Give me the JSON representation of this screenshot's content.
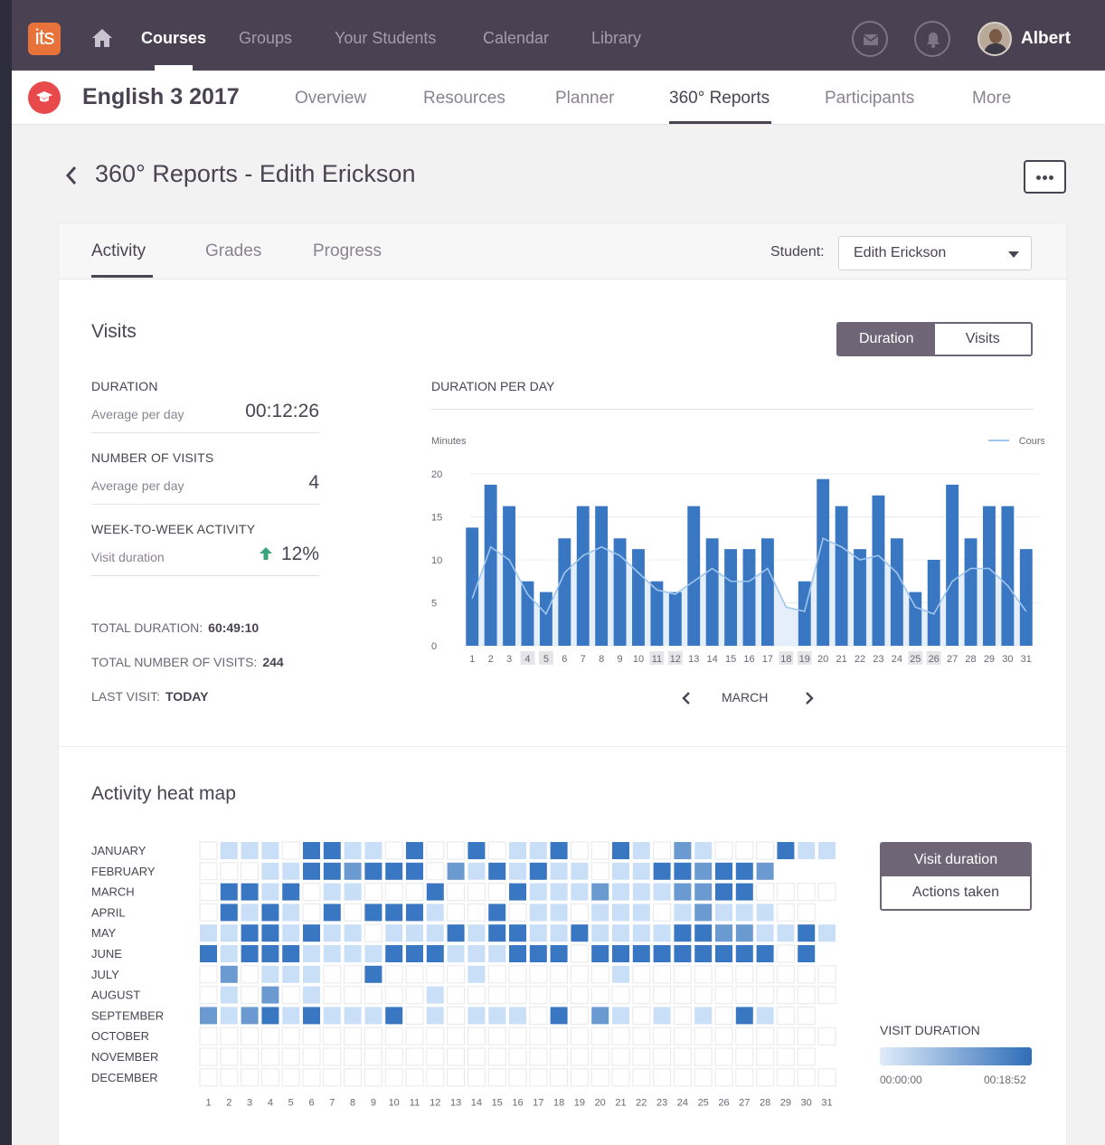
{
  "topbar": {
    "logo": "its",
    "nav": [
      "Courses",
      "Groups",
      "Your Students",
      "Calendar",
      "Library"
    ],
    "active_nav": "Courses",
    "user": "Albert"
  },
  "course": {
    "title": "English 3 2017",
    "tabs": [
      "Overview",
      "Resources",
      "Planner",
      "360° Reports",
      "Participants",
      "More"
    ],
    "active_tab": "360° Reports"
  },
  "page": {
    "title": "360° Reports - Edith Erickson"
  },
  "report": {
    "tabs": [
      "Activity",
      "Grades",
      "Progress"
    ],
    "active_tab": "Activity",
    "student_label": "Student:",
    "student": "Edith Erickson"
  },
  "visits": {
    "title": "Visits",
    "toggle": [
      "Duration",
      "Visits"
    ],
    "duration_label": "DURATION",
    "duration_sub": "Average per day",
    "duration_value": "00:12:26",
    "visits_label": "NUMBER OF VISITS",
    "visits_sub": "Average per day",
    "visits_value": "4",
    "week_label": "WEEK-TO-WEEK ACTIVITY",
    "week_sub": "Visit duration",
    "week_value": "12%",
    "total_duration_label": "TOTAL DURATION:",
    "total_duration": "60:49:10",
    "total_visits_label": "TOTAL NUMBER OF VISITS:",
    "total_visits": "244",
    "last_visit_label": "LAST VISIT:",
    "last_visit": "TODAY"
  },
  "chart_data": {
    "type": "bar",
    "title": "DURATION PER DAY",
    "ylabel": "Minutes",
    "ylim": [
      0,
      20
    ],
    "yticks": [
      0,
      5,
      10,
      15,
      20
    ],
    "legend": "Course average",
    "month": "MARCH",
    "categories": [
      "1",
      "2",
      "3",
      "4",
      "5",
      "6",
      "7",
      "8",
      "9",
      "10",
      "11",
      "12",
      "13",
      "14",
      "15",
      "16",
      "17",
      "18",
      "19",
      "20",
      "21",
      "22",
      "23",
      "24",
      "25",
      "26",
      "27",
      "28",
      "29",
      "30",
      "31"
    ],
    "weekend_days": [
      "4",
      "5",
      "11",
      "12",
      "18",
      "19",
      "25",
      "26"
    ],
    "series": [
      {
        "values": [
          13.75,
          18.75,
          16.25,
          7.5,
          6.25,
          12.5,
          16.25,
          16.25,
          12.5,
          11.25,
          7.5,
          6.25,
          16.25,
          12.5,
          11.25,
          11.25,
          12.5,
          0,
          7.5,
          19.4,
          16.25,
          11.25,
          17.5,
          12.5,
          6.25,
          10,
          18.75,
          12.5,
          16.25,
          16.25,
          11.25
        ]
      },
      {
        "name": "Course average",
        "values": [
          5.5,
          11.5,
          10,
          6,
          3.7,
          8.5,
          10.5,
          11.5,
          10.5,
          8.5,
          6.5,
          6,
          7.5,
          9,
          7.5,
          7.5,
          9,
          4.5,
          4,
          12.5,
          11.5,
          10,
          10.5,
          8.5,
          4.5,
          3.7,
          7.5,
          9,
          9,
          7,
          4
        ]
      }
    ],
    "color": "#3a77c2",
    "avg_color": "#9fc6ee"
  },
  "heatmap": {
    "title": "Activity heat map",
    "months": [
      "JANUARY",
      "FEBRUARY",
      "MARCH",
      "APRIL",
      "MAY",
      "JUNE",
      "JULY",
      "AUGUST",
      "SEPTEMBER",
      "OCTOBER",
      "NOVEMBER",
      "DECEMBER"
    ],
    "days": [
      "1",
      "2",
      "3",
      "4",
      "5",
      "6",
      "7",
      "8",
      "9",
      "10",
      "11",
      "12",
      "13",
      "14",
      "15",
      "16",
      "17",
      "18",
      "19",
      "20",
      "21",
      "22",
      "23",
      "24",
      "25",
      "26",
      "27",
      "28",
      "29",
      "30",
      "31"
    ],
    "month_lengths": [
      31,
      28,
      31,
      30,
      31,
      30,
      31,
      31,
      30,
      31,
      30,
      31
    ],
    "levels": [
      [
        0,
        1,
        1,
        1,
        0,
        4,
        4,
        1,
        1,
        0,
        4,
        0,
        0,
        4,
        0,
        1,
        1,
        4,
        0,
        0,
        4,
        1,
        0,
        3,
        1,
        0,
        0,
        0,
        4,
        1,
        1
      ],
      [
        0,
        0,
        0,
        1,
        1,
        4,
        4,
        3,
        4,
        4,
        4,
        0,
        3,
        1,
        4,
        1,
        4,
        1,
        1,
        0,
        1,
        1,
        4,
        4,
        3,
        4,
        4,
        3,
        1,
        4,
        0
      ],
      [
        0,
        4,
        4,
        1,
        4,
        0,
        1,
        1,
        0,
        0,
        0,
        4,
        0,
        0,
        0,
        4,
        1,
        1,
        1,
        3,
        1,
        1,
        1,
        3,
        3,
        4,
        4,
        0,
        0,
        0,
        0
      ],
      [
        0,
        4,
        1,
        4,
        1,
        0,
        4,
        0,
        4,
        4,
        4,
        1,
        0,
        0,
        4,
        0,
        1,
        1,
        0,
        1,
        1,
        1,
        0,
        1,
        3,
        1,
        1,
        1,
        0,
        0,
        0
      ],
      [
        1,
        1,
        4,
        4,
        1,
        4,
        1,
        1,
        0,
        1,
        1,
        1,
        4,
        1,
        4,
        4,
        1,
        1,
        4,
        1,
        1,
        1,
        1,
        4,
        4,
        3,
        3,
        1,
        1,
        4,
        1
      ],
      [
        4,
        1,
        4,
        4,
        4,
        1,
        1,
        1,
        1,
        4,
        4,
        4,
        1,
        1,
        1,
        4,
        4,
        4,
        0,
        4,
        4,
        4,
        4,
        4,
        4,
        4,
        4,
        4,
        0,
        4,
        0
      ],
      [
        0,
        3,
        0,
        1,
        1,
        1,
        0,
        0,
        4,
        0,
        0,
        0,
        0,
        1,
        0,
        0,
        0,
        0,
        0,
        0,
        1,
        0,
        0,
        0,
        0,
        0,
        0,
        0,
        0,
        0,
        0
      ],
      [
        0,
        1,
        0,
        3,
        0,
        1,
        0,
        0,
        0,
        0,
        0,
        1,
        0,
        0,
        0,
        0,
        0,
        0,
        0,
        0,
        0,
        0,
        0,
        0,
        0,
        0,
        0,
        0,
        0,
        0,
        0
      ],
      [
        3,
        1,
        3,
        4,
        1,
        4,
        1,
        1,
        1,
        4,
        0,
        1,
        0,
        1,
        1,
        1,
        0,
        4,
        0,
        3,
        1,
        0,
        1,
        0,
        1,
        0,
        4,
        1,
        0,
        0,
        0
      ],
      [
        0,
        0,
        0,
        0,
        0,
        0,
        0,
        0,
        0,
        0,
        0,
        0,
        0,
        0,
        0,
        0,
        0,
        0,
        0,
        0,
        0,
        0,
        0,
        0,
        0,
        0,
        0,
        0,
        0,
        0,
        0
      ],
      [
        0,
        0,
        0,
        0,
        0,
        0,
        0,
        0,
        0,
        0,
        0,
        0,
        0,
        0,
        0,
        0,
        0,
        0,
        0,
        0,
        0,
        0,
        0,
        0,
        0,
        0,
        0,
        0,
        0,
        0,
        0
      ],
      [
        0,
        0,
        0,
        0,
        0,
        0,
        0,
        0,
        0,
        0,
        0,
        0,
        0,
        0,
        0,
        0,
        0,
        0,
        0,
        0,
        0,
        0,
        0,
        0,
        0,
        0,
        0,
        0,
        0,
        0,
        0
      ]
    ],
    "level_colors": [
      "#ffffff",
      "#c9dff7",
      "#8db8e6",
      "#6a9ad0",
      "#3a77c2"
    ],
    "toggle": [
      "Visit duration",
      "Actions taken"
    ],
    "legend_title": "VISIT DURATION",
    "legend_min": "00:00:00",
    "legend_max": "00:18:52"
  }
}
